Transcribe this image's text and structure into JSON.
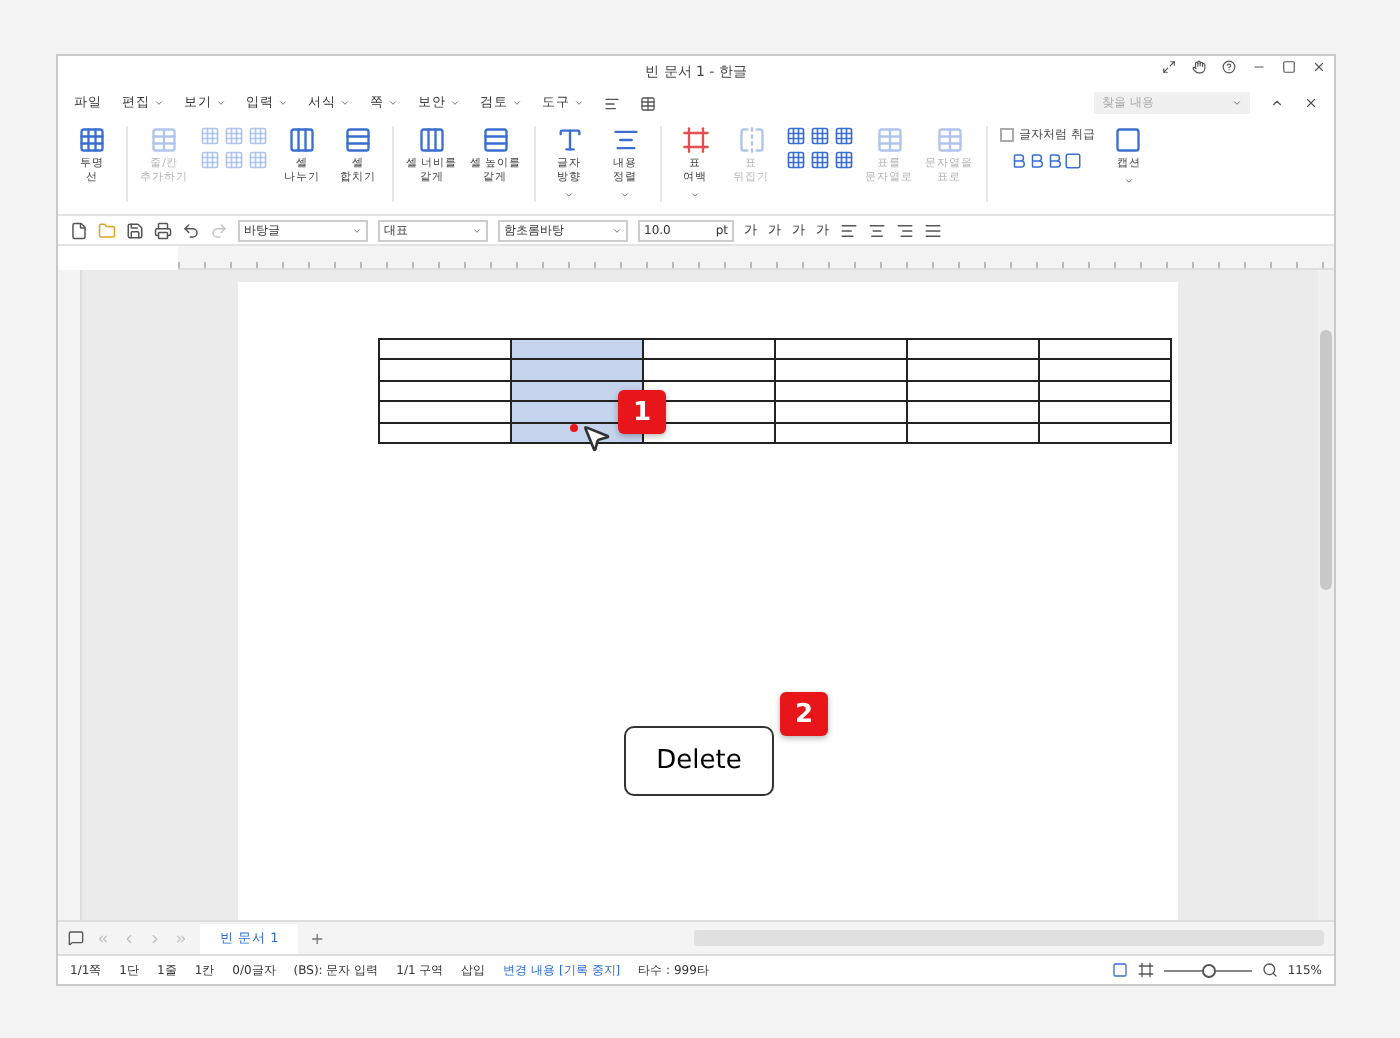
{
  "window": {
    "title": "빈 문서 1 - 한글"
  },
  "menu": [
    {
      "label": "파일",
      "caret": false
    },
    {
      "label": "편집",
      "caret": true
    },
    {
      "label": "보기",
      "caret": true
    },
    {
      "label": "입력",
      "caret": true
    },
    {
      "label": "서식",
      "caret": true
    },
    {
      "label": "쪽",
      "caret": true
    },
    {
      "label": "보안",
      "caret": true
    },
    {
      "label": "검토",
      "caret": true
    },
    {
      "label": "도구",
      "caret": true
    }
  ],
  "search": {
    "placeholder": "찾을 내용"
  },
  "ribbon": [
    {
      "kind": "button",
      "label": "투명\n선",
      "disabled": false,
      "caret": false
    },
    {
      "kind": "button",
      "label": "줄/칸\n추가하기",
      "disabled": true,
      "caret": false
    },
    {
      "kind": "cluster",
      "disabled": true
    },
    {
      "kind": "button",
      "label": "셀\n나누기",
      "disabled": false,
      "caret": false
    },
    {
      "kind": "button",
      "label": "셀\n합치기",
      "disabled": false,
      "caret": false
    },
    {
      "kind": "button",
      "label": "셀 너비를\n같게",
      "disabled": false,
      "caret": false
    },
    {
      "kind": "button",
      "label": "셀 높이를\n같게",
      "disabled": false,
      "caret": false
    },
    {
      "kind": "button",
      "label": "글자\n방향",
      "disabled": false,
      "caret": true
    },
    {
      "kind": "button",
      "label": "내용\n정렬",
      "disabled": false,
      "caret": true
    },
    {
      "kind": "button",
      "label": "표\n여백",
      "disabled": false,
      "caret": true
    },
    {
      "kind": "button",
      "label": "표\n뒤집기",
      "disabled": true,
      "caret": false
    },
    {
      "kind": "cluster",
      "disabled": false
    },
    {
      "kind": "button",
      "label": "표를\n문자열로",
      "disabled": true,
      "caret": false
    },
    {
      "kind": "button",
      "label": "문자열을\n표로",
      "disabled": true,
      "caret": false
    },
    {
      "kind": "checkbox",
      "label": "글자처럼 취급",
      "checked": false
    },
    {
      "kind": "button",
      "label": "캡션",
      "disabled": false,
      "caret": true
    }
  ],
  "format": {
    "style": "바탕글",
    "lang": "대표",
    "font": "함초롬바탕",
    "size": "10.0",
    "unit": "pt",
    "chars": [
      "가",
      "가",
      "가",
      "가"
    ]
  },
  "table": {
    "rows": [
      {
        "cells": [
          {
            "selected": false
          },
          {
            "selected": true
          },
          {
            "selected": false
          },
          {
            "selected": false
          },
          {
            "selected": false
          },
          {
            "selected": false
          }
        ]
      },
      {
        "cells": [
          {
            "selected": false
          },
          {
            "selected": true
          },
          {
            "selected": false
          },
          {
            "selected": false
          },
          {
            "selected": false
          },
          {
            "selected": false
          }
        ]
      },
      {
        "cells": [
          {
            "selected": false
          },
          {
            "selected": true
          },
          {
            "selected": false
          },
          {
            "selected": false
          },
          {
            "selected": false
          },
          {
            "selected": false
          }
        ]
      },
      {
        "cells": [
          {
            "selected": false
          },
          {
            "selected": true
          },
          {
            "selected": false
          },
          {
            "selected": false
          },
          {
            "selected": false
          },
          {
            "selected": false
          }
        ]
      },
      {
        "cells": [
          {
            "selected": false
          },
          {
            "selected": true
          },
          {
            "selected": false
          },
          {
            "selected": false
          },
          {
            "selected": false
          },
          {
            "selected": false
          }
        ]
      }
    ]
  },
  "steps": [
    {
      "label": "1"
    },
    {
      "label": "2"
    }
  ],
  "key": {
    "label": "Delete"
  },
  "doc_tabs": [
    {
      "label": "빈 문서 1",
      "selected": true
    }
  ],
  "add_tab": {
    "label": "+"
  },
  "status_bar": {
    "items": [
      {
        "text": "1/1쪽",
        "link": false
      },
      {
        "text": "1단",
        "link": false
      },
      {
        "text": "1줄",
        "link": false
      },
      {
        "text": "1칸",
        "link": false
      },
      {
        "text": "0/0글자",
        "link": false
      },
      {
        "text": "(BS): 문자 입력",
        "link": false
      },
      {
        "text": "1/1 구역",
        "link": false
      },
      {
        "text": "삽입",
        "link": false
      },
      {
        "text": "변경 내용 [기록 중지]",
        "link": true
      },
      {
        "text": "타수 : 999타",
        "link": false
      }
    ],
    "zoom": {
      "level": 0.5,
      "reading": "115%"
    }
  }
}
